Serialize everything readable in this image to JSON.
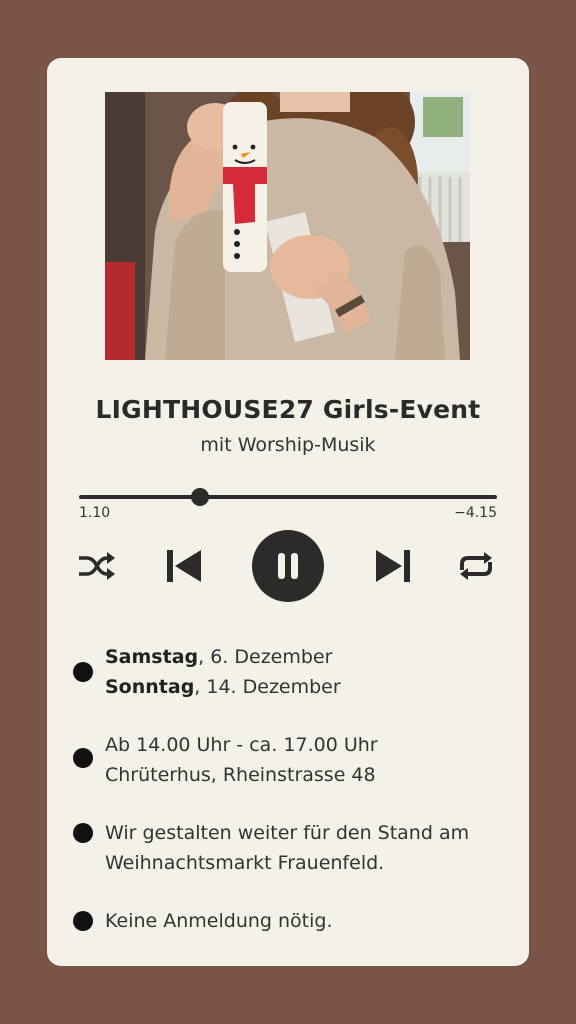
{
  "event": {
    "title": "LIGHTHOUSE27 Girls-Event",
    "subtitle": "mit Worship-Musik"
  },
  "player": {
    "elapsed": "1.10",
    "remaining": "−4.15",
    "progress": 0.29,
    "icons": [
      "shuffle-icon",
      "skip-back-icon",
      "pause-icon",
      "skip-forward-icon",
      "repeat-icon"
    ]
  },
  "details": {
    "date1_day": "Samstag",
    "date1_rest": ", 6. Dezember",
    "date2_day": "Sonntag",
    "date2_rest": ", 14. Dezember",
    "time": "Ab 14.00 Uhr - ca. 17.00 Uhr",
    "location": "Chrüterhus, Rheinstrasse 48",
    "activity_line1": "Wir gestalten weiter für den Stand am",
    "activity_line2": "Weihnachtsmarkt Frauenfeld.",
    "registration": "Keine Anmeldung nötig."
  },
  "colors": {
    "background": "#7a5446",
    "card": "#f4f2e8",
    "controls": "#2b2b2b"
  }
}
